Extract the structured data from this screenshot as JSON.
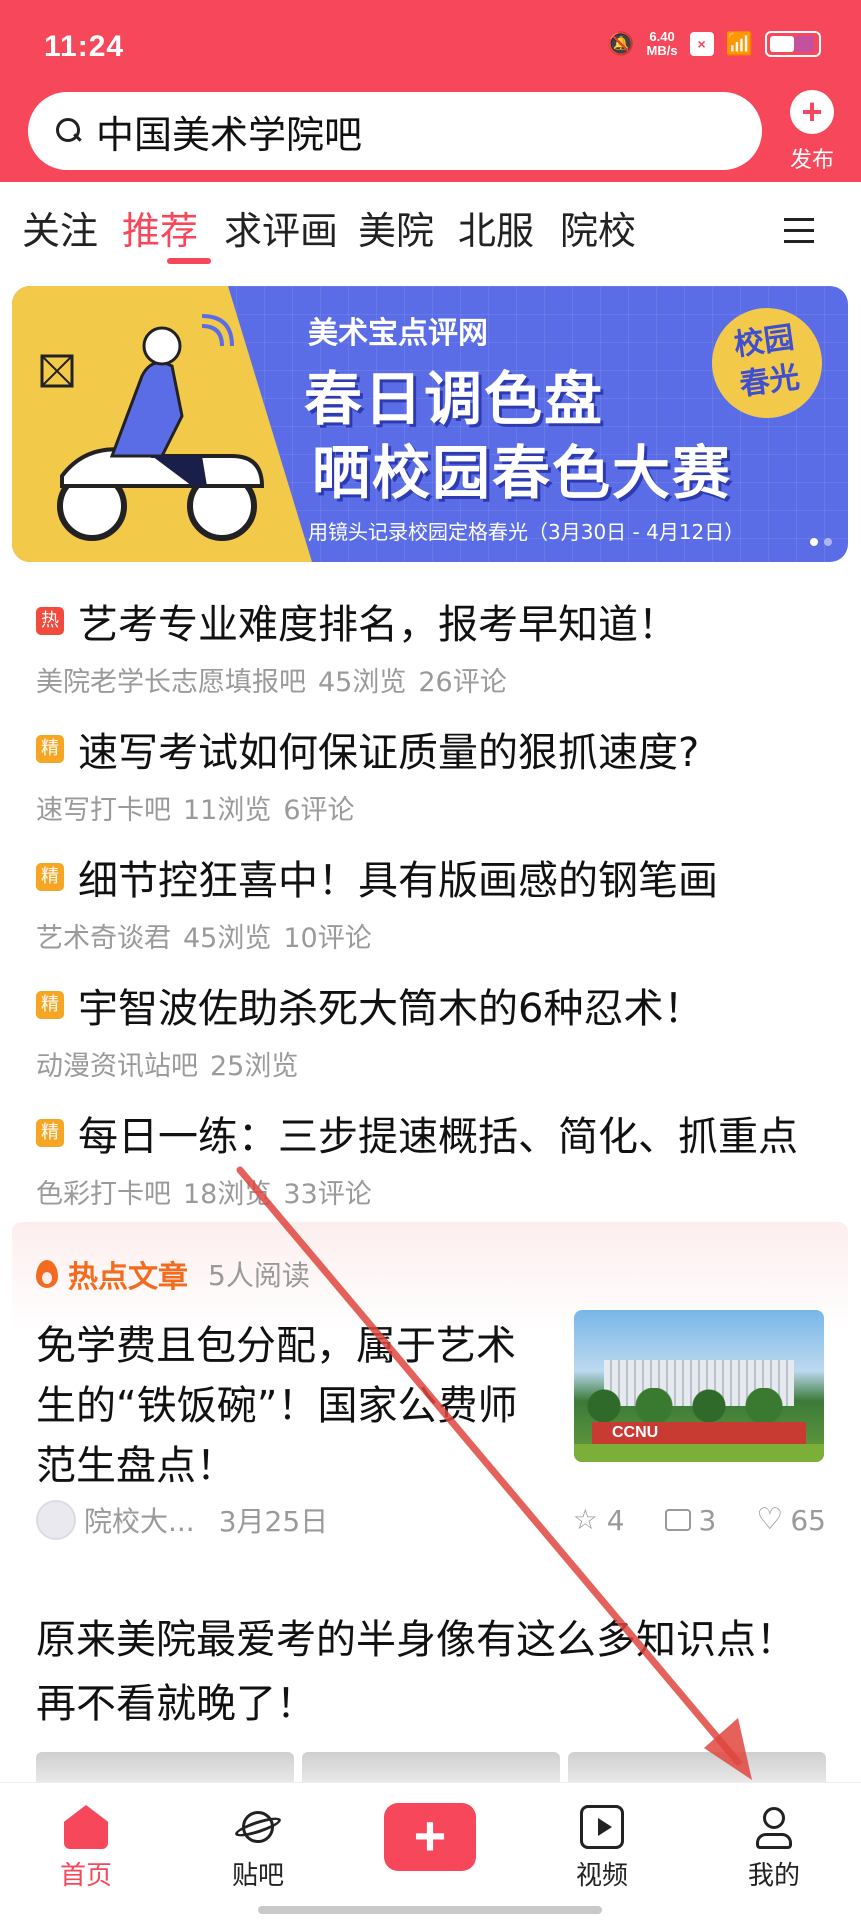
{
  "status_bar": {
    "time": "11:24",
    "speed_value": "6.40",
    "speed_unit": "MB/s"
  },
  "search": {
    "query": "中国美术学院吧"
  },
  "publish": {
    "label": "发布"
  },
  "tabs": [
    "关注",
    "推荐",
    "求评画",
    "美院",
    "北服",
    "院校"
  ],
  "banner": {
    "brand": "美术宝点评网",
    "title_line1": "春日调色盘",
    "title_line2": "晒校园春色大赛",
    "subtitle": "用镜头记录校园定格春光（3月30日 - 4月12日）",
    "badge_line1": "校园",
    "badge_line2": "春光"
  },
  "posts": [
    {
      "tag": "热",
      "title": "艺考专业难度排名，报考早知道！",
      "forum": "美院老学长志愿填报吧",
      "views": "45浏览",
      "comments": "26评论"
    },
    {
      "tag": "精",
      "title": "速写考试如何保证质量的狠抓速度?",
      "forum": "速写打卡吧",
      "views": "11浏览",
      "comments": "6评论"
    },
    {
      "tag": "精",
      "title": "细节控狂喜中！具有版画感的钢笔画",
      "forum": "艺术奇谈君",
      "views": "45浏览",
      "comments": "10评论"
    },
    {
      "tag": "精",
      "title": "宇智波佐助杀死大筒木的6种忍术！",
      "forum": "动漫资讯站吧",
      "views": "25浏览",
      "comments": ""
    },
    {
      "tag": "精",
      "title": "每日一练：三步提速概括、简化、抓重点",
      "forum": "色彩打卡吧",
      "views": "18浏览",
      "comments": "33评论"
    }
  ],
  "hot_article": {
    "label": "热点文章",
    "reads": "5人阅读",
    "title": "免学费且包分配，属于艺术生的“铁饭碗”！国家公费师范生盘点！",
    "image_sign": "CCNU",
    "author": "院校大...",
    "date": "3月25日",
    "stars": "4",
    "comments": "3",
    "likes": "65"
  },
  "article2": {
    "title": "原来美院最爱考的半身像有这么多知识点！再不看就晚了！"
  },
  "bottom_nav": {
    "home": "首页",
    "forum": "贴吧",
    "video": "视频",
    "me": "我的"
  },
  "colors": {
    "accent": "#f7475a",
    "hot_tag": "#f24a3c",
    "jing_tag": "#f6a623",
    "hot_label": "#f36b1f",
    "annotation_arrow": "#e0473f"
  },
  "icons": [
    "search-icon",
    "plus-icon",
    "menu-icon",
    "flame-icon",
    "star-icon",
    "comment-icon",
    "heart-icon",
    "home-icon",
    "planet-icon",
    "video-icon",
    "me-icon"
  ]
}
